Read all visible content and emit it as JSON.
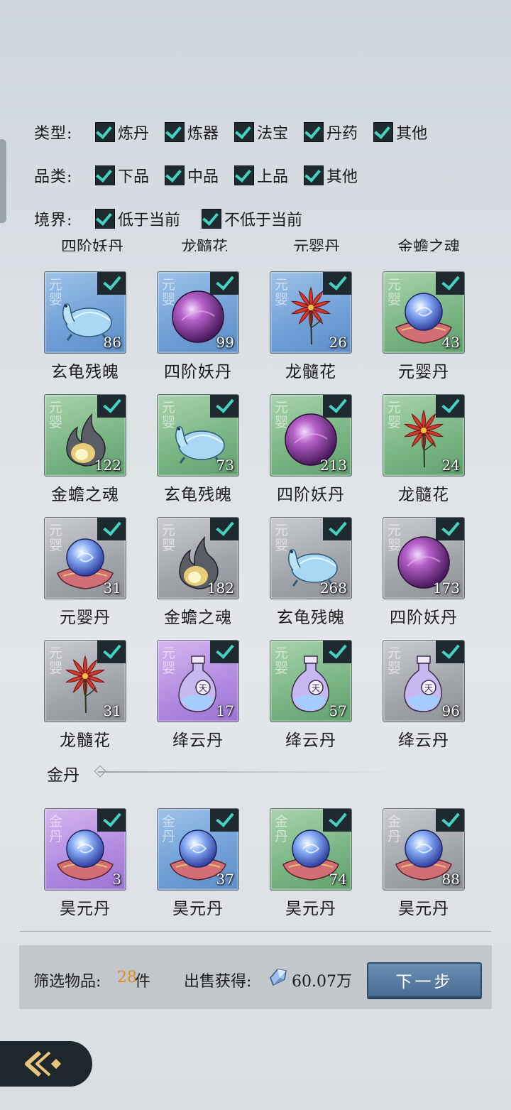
{
  "filters": {
    "type": {
      "label": "类型:",
      "options": [
        "炼丹",
        "炼器",
        "法宝",
        "丹药",
        "其他"
      ]
    },
    "grade": {
      "label": "品类:",
      "options": [
        "下品",
        "中品",
        "上品",
        "其他"
      ]
    },
    "realm": {
      "label": "境界:",
      "options": [
        "低于当前",
        "不低于当前"
      ]
    }
  },
  "partial_row_names": [
    "四阶妖丹",
    "龙髓花",
    "元婴丹",
    "金蟾之魂"
  ],
  "yuanying_items": [
    {
      "name": "玄龟残魄",
      "count": "86",
      "quality": "blue",
      "icon": "turtle-icon",
      "realm": "元婴"
    },
    {
      "name": "四阶妖丹",
      "count": "99",
      "quality": "blue",
      "icon": "purple-orb-icon",
      "realm": "元婴"
    },
    {
      "name": "龙髓花",
      "count": "26",
      "quality": "blue",
      "icon": "red-flower-icon",
      "realm": "元婴"
    },
    {
      "name": "元婴丹",
      "count": "43",
      "quality": "green",
      "icon": "blue-orb-cushion-icon",
      "realm": "元婴"
    },
    {
      "name": "金蟾之魂",
      "count": "122",
      "quality": "green",
      "icon": "spirit-flame-icon",
      "realm": "元婴"
    },
    {
      "name": "玄龟残魄",
      "count": "73",
      "quality": "green",
      "icon": "turtle-icon",
      "realm": "元婴"
    },
    {
      "name": "四阶妖丹",
      "count": "213",
      "quality": "green",
      "icon": "purple-orb-icon",
      "realm": "元婴"
    },
    {
      "name": "龙髓花",
      "count": "24",
      "quality": "green",
      "icon": "red-flower-icon",
      "realm": "元婴"
    },
    {
      "name": "元婴丹",
      "count": "31",
      "quality": "gray",
      "icon": "blue-orb-cushion-icon",
      "realm": "元婴"
    },
    {
      "name": "金蟾之魂",
      "count": "182",
      "quality": "gray",
      "icon": "spirit-flame-icon",
      "realm": "元婴"
    },
    {
      "name": "玄龟残魄",
      "count": "268",
      "quality": "gray",
      "icon": "turtle-icon",
      "realm": "元婴"
    },
    {
      "name": "四阶妖丹",
      "count": "173",
      "quality": "gray",
      "icon": "purple-orb-icon",
      "realm": "元婴"
    },
    {
      "name": "龙髓花",
      "count": "31",
      "quality": "gray",
      "icon": "red-flower-icon",
      "realm": "元婴"
    },
    {
      "name": "绛云丹",
      "count": "17",
      "quality": "purple",
      "icon": "potion-bottle-icon",
      "realm": "元婴"
    },
    {
      "name": "绛云丹",
      "count": "57",
      "quality": "green",
      "icon": "potion-bottle-icon",
      "realm": "元婴"
    },
    {
      "name": "绛云丹",
      "count": "96",
      "quality": "gray",
      "icon": "potion-bottle-icon",
      "realm": "元婴"
    }
  ],
  "jindan_section": {
    "title": "金丹",
    "items": [
      {
        "name": "昊元丹",
        "count": "3",
        "quality": "purple",
        "icon": "blue-orb-cushion-icon",
        "realm": "金丹"
      },
      {
        "name": "昊元丹",
        "count": "37",
        "quality": "blue",
        "icon": "blue-orb-cushion-icon",
        "realm": "金丹"
      },
      {
        "name": "昊元丹",
        "count": "74",
        "quality": "green",
        "icon": "blue-orb-cushion-icon",
        "realm": "金丹"
      },
      {
        "name": "昊元丹",
        "count": "88",
        "quality": "gray",
        "icon": "blue-orb-cushion-icon",
        "realm": "金丹"
      }
    ]
  },
  "footer": {
    "selected_label": "筛选物品:",
    "selected_count": "28",
    "selected_unit": "件",
    "sale_label": "出售获得:",
    "sale_value": "60.07万",
    "next_button": "下一步",
    "currency_icon": "spirit-stone-icon"
  },
  "colors": {
    "check": "#46d2c2",
    "count_highlight": "#e38a1e",
    "button": "#5a7fa5"
  }
}
